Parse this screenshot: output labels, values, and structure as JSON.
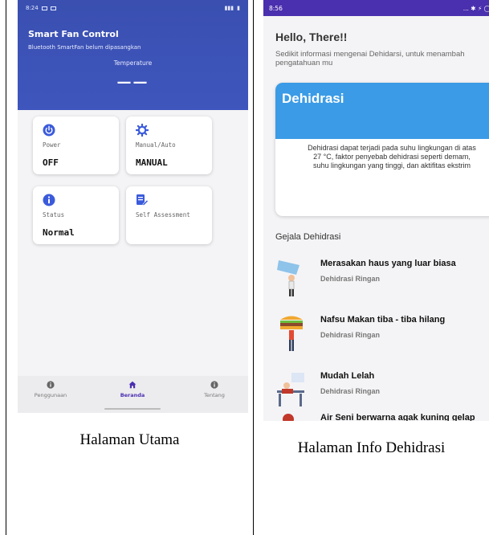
{
  "left_screen": {
    "status_time": "8:24",
    "app_title": "Smart Fan Control",
    "app_subtitle": "Bluetooth SmartFan belum dipasangkan",
    "temperature_label": "Temperature",
    "temperature_value": "——",
    "cards": [
      {
        "label": "Power",
        "value": "OFF",
        "icon": "power-icon",
        "color": "#3b5bdb"
      },
      {
        "label": "Manual/Auto",
        "value": "MANUAL",
        "icon": "gear-icon",
        "color": "#3b5bdb"
      },
      {
        "label": "Status",
        "value": "Normal",
        "icon": "info-icon",
        "color": "#3b5bdb"
      },
      {
        "label": "Self Assessment",
        "value": "",
        "icon": "form-edit-icon",
        "color": "#3b5bdb"
      }
    ],
    "bottom_nav": [
      {
        "label": "Penggunaan",
        "icon": "info-icon",
        "active": false
      },
      {
        "label": "Beranda",
        "icon": "home-icon",
        "active": true
      },
      {
        "label": "Tentang",
        "icon": "info-icon",
        "active": false
      }
    ],
    "caption": "Halaman Utama"
  },
  "right_screen": {
    "status_time": "8:56",
    "status_right": "... ✱ ⚡ ◯",
    "greeting": "Hello, There!!",
    "intro": "Sedikit informasi mengenai Dehidarsi, untuk menambah pengatahuan mu",
    "card_title": "Dehidrasi",
    "card_text_line1": "Dehidrasi dapat terjadi pada suhu lingkungan di atas",
    "card_text_line2": "27 °C, faktor penyebab dehidrasi seperti demam,",
    "card_text_line3": "suhu lingkungan yang tinggi, dan aktifitas ekstrim",
    "section_title": "Gejala Dehidrasi",
    "symptoms": [
      {
        "title": "Merasakan haus yang luar biasa",
        "level": "Dehidrasi Ringan",
        "icon": "drinking-person-icon"
      },
      {
        "title": "Nafsu Makan tiba - tiba hilang",
        "level": "Dehidrasi Ringan",
        "icon": "burger-person-icon"
      },
      {
        "title": "Mudah Lelah",
        "level": "Dehidrasi Ringan",
        "icon": "tired-person-icon"
      },
      {
        "title": "Air Seni berwarna agak kuning gelap",
        "level": "",
        "icon": "person-icon"
      }
    ],
    "caption": "Halaman Info Dehidrasi"
  },
  "colors": {
    "header_blue": "#3e56bd",
    "accent_purple": "#4a2fae",
    "card_blue": "#3b9be6"
  }
}
